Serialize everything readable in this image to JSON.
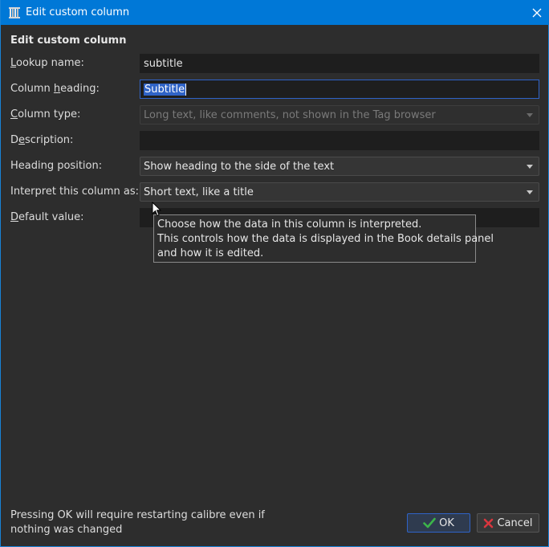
{
  "window": {
    "title": "Edit custom column",
    "app_icon": "calibre-library-icon",
    "accent_color": "#0078d7"
  },
  "form": {
    "heading": "Edit custom column",
    "lookup_name": {
      "label_pre": "",
      "label_key": "L",
      "label_post": "ookup name:",
      "value": "subtitle"
    },
    "column_heading": {
      "label_pre": "Column ",
      "label_key": "h",
      "label_post": "eading:",
      "value": "Subtitle"
    },
    "column_type": {
      "label_pre": "",
      "label_key": "C",
      "label_post": "olumn type:",
      "value": "Long text, like comments, not shown in the Tag browser"
    },
    "description": {
      "label_pre": "D",
      "label_key": "e",
      "label_post": "scription:",
      "value": ""
    },
    "heading_position": {
      "label": "Heading position:",
      "value": "Show heading to the side of the text"
    },
    "interpret_as": {
      "label": "Interpret this column as:",
      "value": "Short text, like a title"
    },
    "default_value": {
      "label_pre": "",
      "label_key": "D",
      "label_post": "efault value:",
      "value": ""
    }
  },
  "tooltip": {
    "lines": [
      "Choose how the data in this column is interpreted.",
      "This controls how the data is displayed in the Book details panel",
      "and how it is edited."
    ]
  },
  "footer": {
    "note_line1": "Pressing OK will require restarting calibre even if",
    "note_line2": "nothing was changed",
    "ok_label": "OK",
    "cancel_label": "Cancel",
    "ok_icon": "checkmark-icon",
    "cancel_icon": "cross-icon",
    "ok_icon_color": "#3cb44a",
    "cancel_icon_color": "#d9363e"
  }
}
